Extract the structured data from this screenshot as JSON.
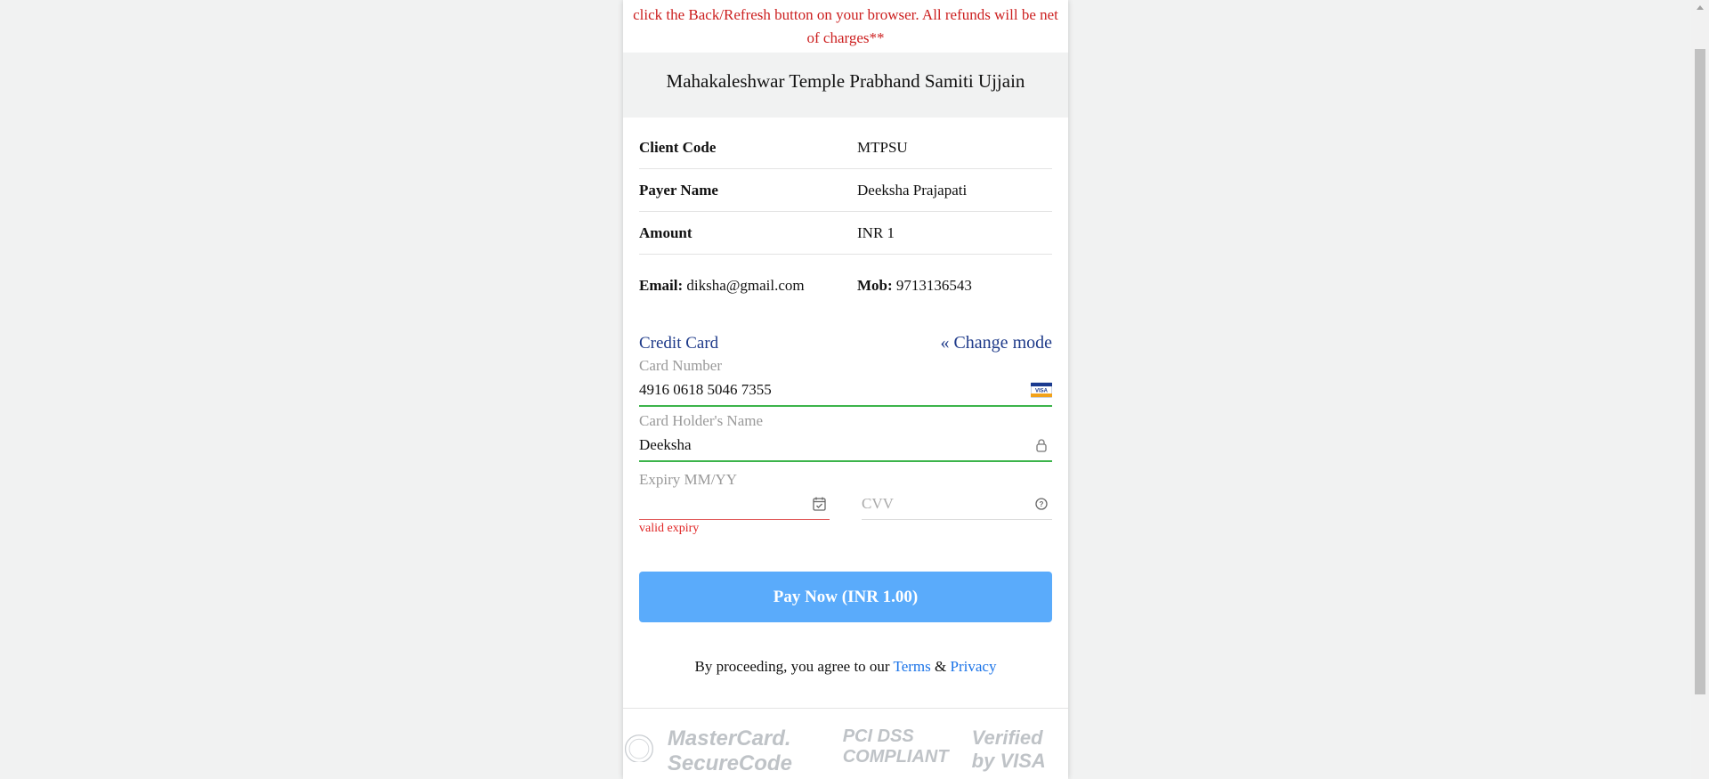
{
  "warning": {
    "line1": "click the Back/Refresh button on your browser. All refunds will be net",
    "line2": "of charges**"
  },
  "merchant": {
    "name": "Mahakaleshwar Temple Prabhand Samiti Ujjain"
  },
  "details": {
    "client_code_label": "Client Code",
    "client_code": "MTPSU",
    "payer_name_label": "Payer Name",
    "payer_name": "Deeksha Prajapati",
    "amount_label": "Amount",
    "amount": "INR 1",
    "email_label": "Email:",
    "email": "diksha@gmail.com",
    "mob_label": "Mob:",
    "mob": "9713136543"
  },
  "payment": {
    "mode": "Credit Card",
    "change_mode": "Change mode",
    "card_number_label": "Card Number",
    "card_number": "4916 0618 5046 7355",
    "card_brand_icon": "visa-card-icon",
    "holder_label": "Card Holder's Name",
    "holder_value": "Deeksha",
    "expiry_label": "Expiry MM/YY",
    "expiry_value": "",
    "cvv_placeholder": "CVV",
    "expiry_error": "valid expiry",
    "pay_button": "Pay Now (INR 1.00)"
  },
  "agreement": {
    "prefix": "By proceeding, you agree to our ",
    "terms": "Terms",
    "amp": " & ",
    "privacy": "Privacy"
  },
  "footer_logos": [
    "MasterCard. SecureCode",
    "PCI DSS COMPLIANT",
    "Verified by VISA"
  ],
  "colors": {
    "accent_blue": "#1f3b8a",
    "pay_button": "#5aabfb",
    "valid_green": "#3cb44b",
    "error_red": "#e02424"
  }
}
